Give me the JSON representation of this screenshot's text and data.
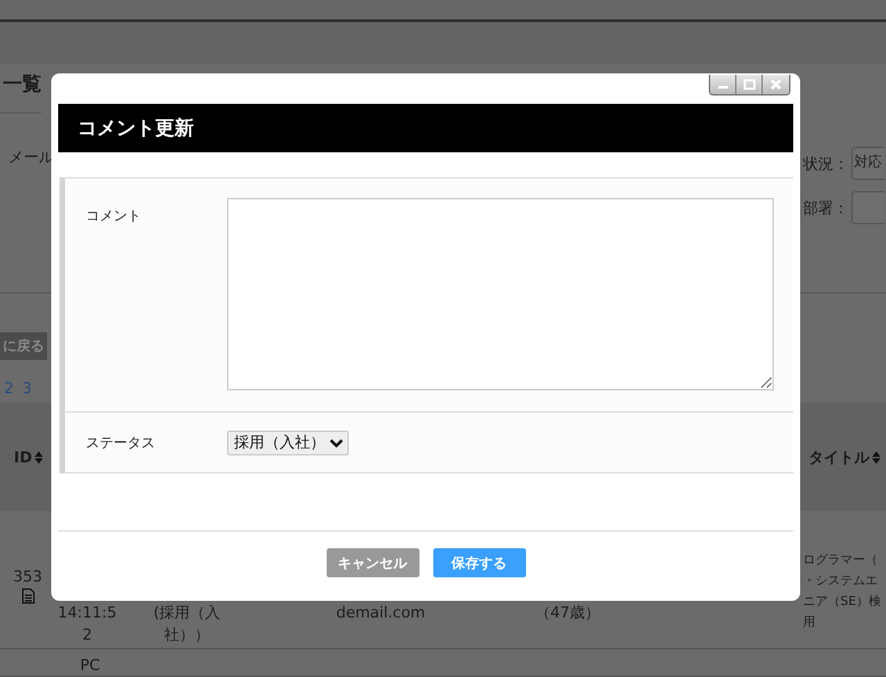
{
  "background": {
    "page_title": "一覧",
    "filters": [
      {
        "label": "メール"
      },
      {
        "label": "状況：",
        "value": "対応"
      },
      {
        "label": "部署："
      }
    ],
    "back_button": "に戻る",
    "pages": [
      "2",
      "3"
    ],
    "table": {
      "columns": [
        {
          "label": "ID"
        },
        {
          "label": "タイトル"
        }
      ],
      "rows": [
        {
          "id": "353",
          "cells": [
            "14:11:52",
            "(採用（入社））",
            "demail.com",
            "（47歳）"
          ],
          "title_lines": [
            "ログラマー（",
            "・システムエ",
            "ニア（SE）検",
            "用"
          ]
        },
        {
          "cells": [
            "PC"
          ]
        }
      ]
    }
  },
  "dialog": {
    "title": "コメント更新",
    "window_buttons": [
      {
        "kind": "minimize"
      },
      {
        "kind": "maximize"
      },
      {
        "kind": "close"
      }
    ],
    "fields": [
      {
        "kind": "textarea",
        "label": "コメント"
      },
      {
        "kind": "select",
        "label": "ステータス",
        "value": "採用（入社）"
      }
    ],
    "buttons": [
      {
        "kind": "secondary",
        "label": "キャンセル"
      },
      {
        "kind": "primary",
        "label": "保存する"
      }
    ]
  }
}
